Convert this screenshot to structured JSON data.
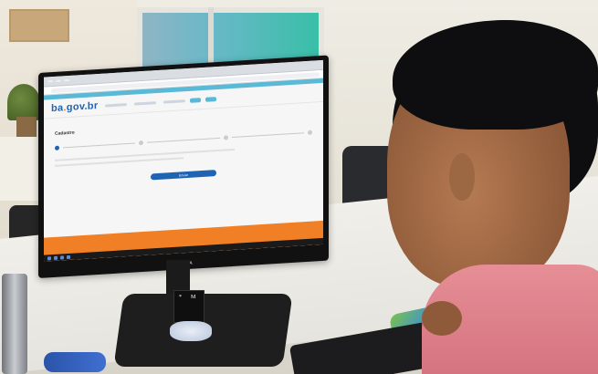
{
  "photo": {
    "subject": "person using desktop computer"
  },
  "screen": {
    "logo_main": "ba",
    "logo_dot": ".",
    "logo_gov": "gov",
    "logo_tld": ".br",
    "page_title": "Cadastro",
    "button_label": "Enviar"
  },
  "monitor": {
    "brand": "DAHUA"
  },
  "sticker": {
    "star": "*",
    "letter": "M"
  },
  "colors": {
    "site_blue": "#1f63b3",
    "site_orange": "#f07f26",
    "site_cyan": "#5ab9d6"
  }
}
